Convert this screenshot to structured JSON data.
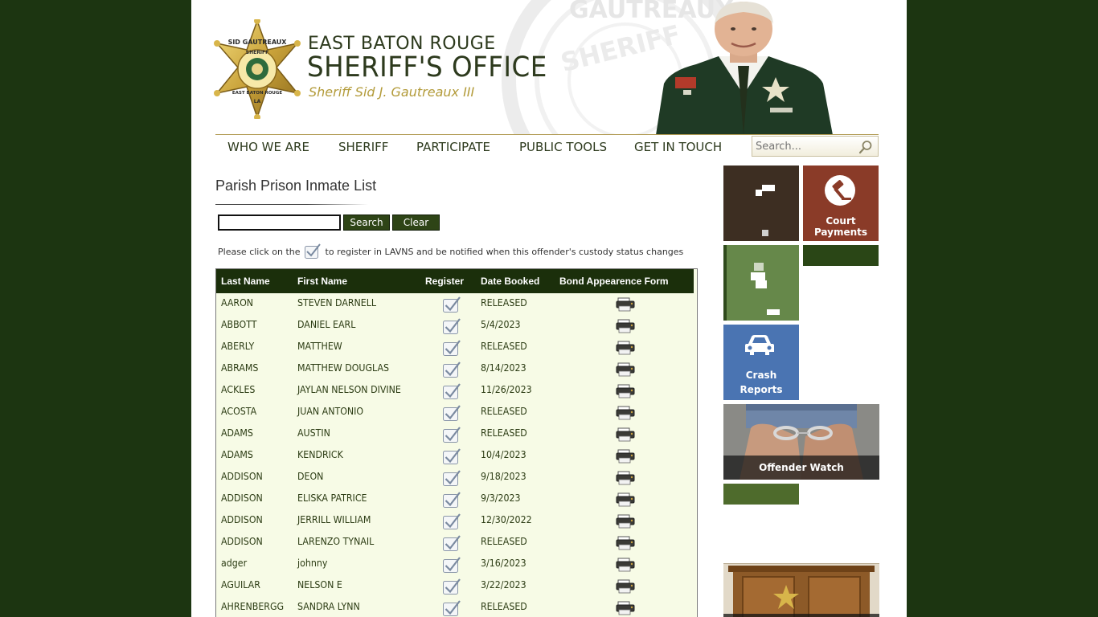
{
  "header": {
    "org_line1": "EAST BATON ROUGE",
    "org_line2": "SHERIFF'S OFFICE",
    "org_line3": "Sheriff Sid J. Gautreaux III",
    "badge_text_top": "SID GAUTREAUX",
    "badge_text_mid": "SHERIFF",
    "badge_text_bottom": "EAST BATON ROUGE",
    "badge_text_state": "LA",
    "watermark_text_1": "GAUTREAUX",
    "watermark_text_2": "SHERIFF"
  },
  "nav": {
    "items": [
      {
        "label": "WHO WE ARE"
      },
      {
        "label": "SHERIFF"
      },
      {
        "label": "PARTICIPATE"
      },
      {
        "label": "PUBLIC TOOLS"
      },
      {
        "label": "GET IN TOUCH"
      }
    ],
    "search_placeholder": "Search..."
  },
  "content": {
    "title": "Parish Prison Inmate List",
    "query_value": "",
    "search_label": "Search",
    "clear_label": "Clear",
    "note_before": "Please click on the",
    "note_after": "to register in LAVNS and be notified when this offender's custody status changes"
  },
  "table": {
    "headers": {
      "last_name": "Last Name",
      "first_name": "First Name",
      "register": "Register",
      "date_booked": "Date Booked",
      "bond_form": "Bond Appearence Form"
    },
    "rows": [
      {
        "last": "AARON",
        "first": "STEVEN DARNELL",
        "date": "RELEASED"
      },
      {
        "last": "ABBOTT",
        "first": "DANIEL EARL",
        "date": "5/4/2023"
      },
      {
        "last": "ABERLY",
        "first": "MATTHEW",
        "date": "RELEASED"
      },
      {
        "last": "ABRAMS",
        "first": "MATTHEW DOUGLAS",
        "date": "8/14/2023"
      },
      {
        "last": "ACKLES",
        "first": "JAYLAN NELSON DIVINE",
        "date": "11/26/2023"
      },
      {
        "last": "ACOSTA",
        "first": "JUAN ANTONIO",
        "date": "RELEASED"
      },
      {
        "last": "ADAMS",
        "first": "AUSTIN",
        "date": "RELEASED"
      },
      {
        "last": "ADAMS",
        "first": "KENDRICK",
        "date": "10/4/2023"
      },
      {
        "last": "ADDISON",
        "first": "DEON",
        "date": "9/18/2023"
      },
      {
        "last": "ADDISON",
        "first": "ELISKA PATRICE",
        "date": "9/3/2023"
      },
      {
        "last": "ADDISON",
        "first": "JERRILL WILLIAM",
        "date": "12/30/2022"
      },
      {
        "last": "ADDISON",
        "first": "LARENZO TYNAIL",
        "date": "RELEASED"
      },
      {
        "last": "adger",
        "first": "johnny",
        "date": "3/16/2023"
      },
      {
        "last": "AGUILAR",
        "first": "NELSON E",
        "date": "3/22/2023"
      },
      {
        "last": "AHRENBERGG",
        "first": "SANDRA LYNN",
        "date": "RELEASED"
      }
    ]
  },
  "sidebar": {
    "court_payments_line1": "Court",
    "court_payments_line2": "Payments",
    "crash_reports_line1": "Crash",
    "crash_reports_line2": "Reports",
    "offender_watch": "Offender Watch"
  },
  "colors": {
    "background": "#1c3511",
    "table_header": "#1b2f0b",
    "table_body": "#f7fbe6",
    "tile_dark_brown": "#3d2e22",
    "tile_court": "#8a3b28",
    "tile_green": "#66884a",
    "tile_dark_green": "#2a4616",
    "tile_blue": "#4a74b2",
    "tile_olive": "#4e6b2c",
    "gold": "#b39b3a"
  }
}
